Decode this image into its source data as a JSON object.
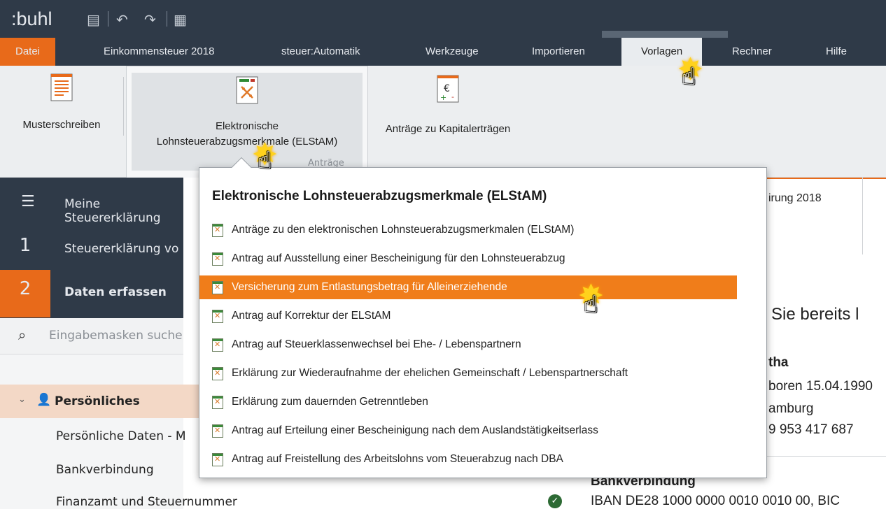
{
  "titlebar": {
    "app_logo": ":buhl",
    "icons": [
      "save-icon",
      "undo-icon",
      "redo-icon",
      "calculator-icon"
    ]
  },
  "menu": {
    "items": [
      "Datei",
      "Einkommensteuer 2018",
      "steuer:Automatik",
      "Werkzeuge",
      "Importieren",
      "Vorlagen",
      "Rechner",
      "Hilfe"
    ],
    "active": "Vorlagen"
  },
  "ribbon": {
    "musterschreiben": "Musterschreiben",
    "elstam_line1": "Elektronische",
    "elstam_line2": "Lohnsteuerabzugsmerkmale (ELStAM)",
    "kapital": "Anträge zu Kapitalerträgen",
    "group_label": "Anträge"
  },
  "sidebar": {
    "header": "Meine Steuererklärung",
    "step1_num": "1",
    "step1_label": "Steuererklärung vo",
    "step2_num": "2",
    "step2_label": "Daten erfassen",
    "search_placeholder": "Eingabemasken suche"
  },
  "tree": {
    "section": "Persönliches",
    "items": [
      "Persönliche Daten - M",
      "Bankverbindung",
      "Finanzamt und Steuernummer"
    ]
  },
  "popup": {
    "title": "Elektronische Lohnsteuerabzugsmerkmale (ELStAM)",
    "items": [
      "Anträge zu den elektronischen Lohnsteuerabzugsmerkmalen (ELStAM)",
      "Antrag auf Ausstellung einer Bescheinigung für den Lohnsteuerabzug",
      "Versicherung zum Entlastungsbetrag für Alleinerziehende",
      "Antrag auf Korrektur der ELStAM",
      "Antrag auf Steuerklassenwechsel bei Ehe- / Lebenspartnern",
      "Erklärung zur Wiederaufnahme der ehelichen Gemeinschaft / Lebenspartnerschaft",
      "Erklärung zum dauernden Getrenntleben",
      "Antrag auf Erteilung einer Bescheinigung nach dem Auslandstätigkeitserlass",
      "Antrag auf Freistellung des Arbeitslohns vom Steuerabzug nach DBA"
    ],
    "active_index": 2
  },
  "main": {
    "tab_partial": "irung 2018",
    "heading_partial": "n Sie bereits l",
    "name_partial": "tha",
    "born_partial": "boren 15.04.1990",
    "city_partial": "amburg",
    "phone_partial": "9 953 417 687",
    "bank_label": "Bankverbindung",
    "iban_partial": "IBAN DE28 1000 0000 0010 0010 00, BIC"
  },
  "colors": {
    "accent": "#e86a1a",
    "dark": "#2f3a48",
    "highlight": "#f07d1a"
  }
}
